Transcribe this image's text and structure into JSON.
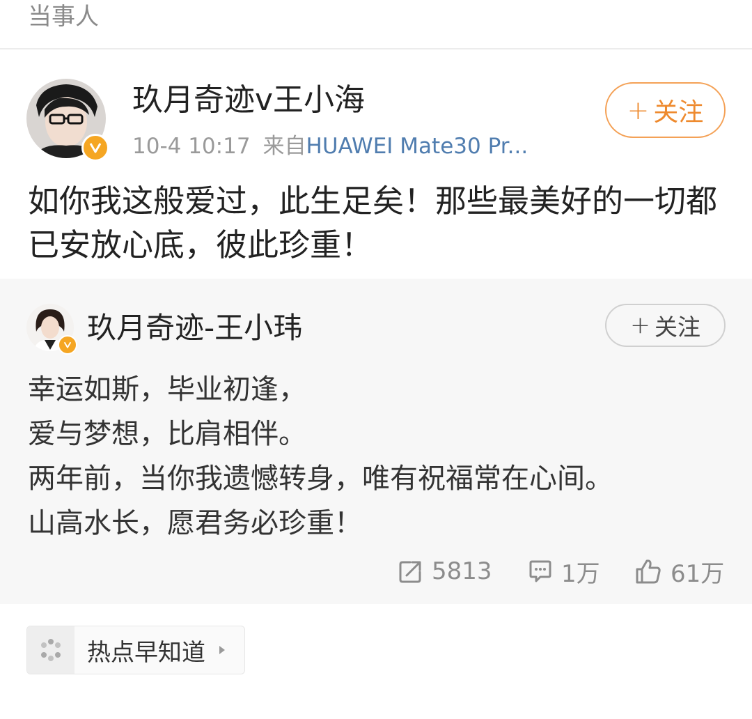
{
  "header": {
    "label": "当事人"
  },
  "post": {
    "author": "玖月奇迹v王小海",
    "time": "10-4 10:17",
    "source_prefix": "来自",
    "device": "HUAWEI Mate30 Pr...",
    "follow_label": "关注",
    "text": "如你我这般爱过，此生足矣！那些最美好的一切都已安放心底，彼此珍重！"
  },
  "retweet": {
    "author": "玖月奇迹-王小玮",
    "follow_label": "关注",
    "lines": [
      "幸运如斯，毕业初逢，",
      "爱与梦想，比肩相伴。",
      "两年前，当你我遗憾转身，唯有祝福常在心间。",
      "山高水长，愿君务必珍重！"
    ],
    "reposts": "5813",
    "comments": "1万",
    "likes": "61万"
  },
  "topic": {
    "label": "热点早知道"
  },
  "colors": {
    "accent": "#ee8a2e",
    "link": "#507daf",
    "badge": "#f5a623"
  },
  "icons": [
    "verified-badge-icon",
    "repost-icon",
    "comment-icon",
    "like-icon",
    "topic-dots-icon",
    "triangle-right-icon"
  ]
}
